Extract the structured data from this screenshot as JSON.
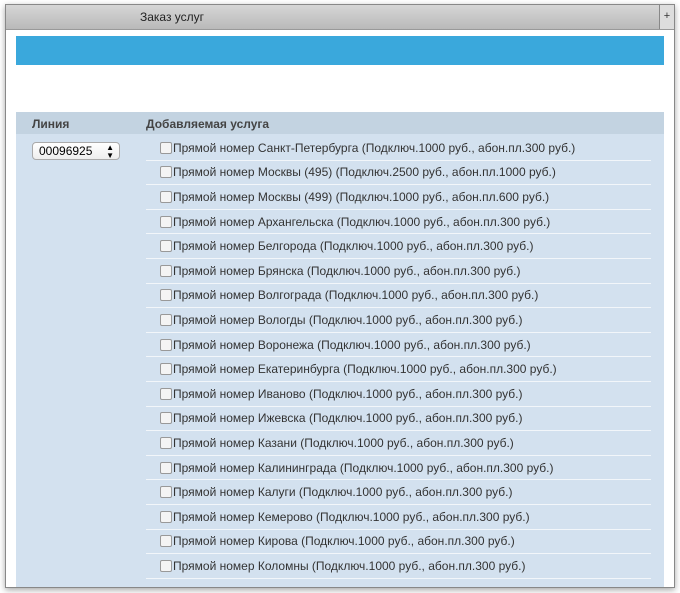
{
  "window": {
    "title": "Заказ услуг",
    "corner_icon": "plus-icon"
  },
  "table": {
    "col_line": "Линия",
    "col_service": "Добавляемая услуга",
    "line_value": "00096925",
    "services": [
      "Прямой номер Санкт-Петербурга (Подключ.1000 руб., абон.пл.300 руб.)",
      "Прямой номер Москвы (495) (Подключ.2500 руб., абон.пл.1000 руб.)",
      "Прямой номер Москвы (499) (Подключ.1000 руб., абон.пл.600 руб.)",
      "Прямой номер Архангельска (Подключ.1000 руб., абон.пл.300 руб.)",
      "Прямой номер Белгорода (Подключ.1000 руб., абон.пл.300 руб.)",
      "Прямой номер Брянска (Подключ.1000 руб., абон.пл.300 руб.)",
      "Прямой номер Волгограда (Подключ.1000 руб., абон.пл.300 руб.)",
      "Прямой номер Вологды (Подключ.1000 руб., абон.пл.300 руб.)",
      "Прямой номер Воронежа (Подключ.1000 руб., абон.пл.300 руб.)",
      "Прямой номер Екатеринбурга (Подключ.1000 руб., абон.пл.300 руб.)",
      "Прямой номер Иваново (Подключ.1000 руб., абон.пл.300 руб.)",
      "Прямой номер Ижевска (Подключ.1000 руб., абон.пл.300 руб.)",
      "Прямой номер Казани (Подключ.1000 руб., абон.пл.300 руб.)",
      "Прямой номер Калининграда (Подключ.1000 руб., абон.пл.300 руб.)",
      "Прямой номер Калуги (Подключ.1000 руб., абон.пл.300 руб.)",
      "Прямой номер Кемерово (Подключ.1000 руб., абон.пл.300 руб.)",
      "Прямой номер Кирова (Подключ.1000 руб., абон.пл.300 руб.)",
      "Прямой номер Коломны (Подключ.1000 руб., абон.пл.300 руб.)"
    ]
  }
}
